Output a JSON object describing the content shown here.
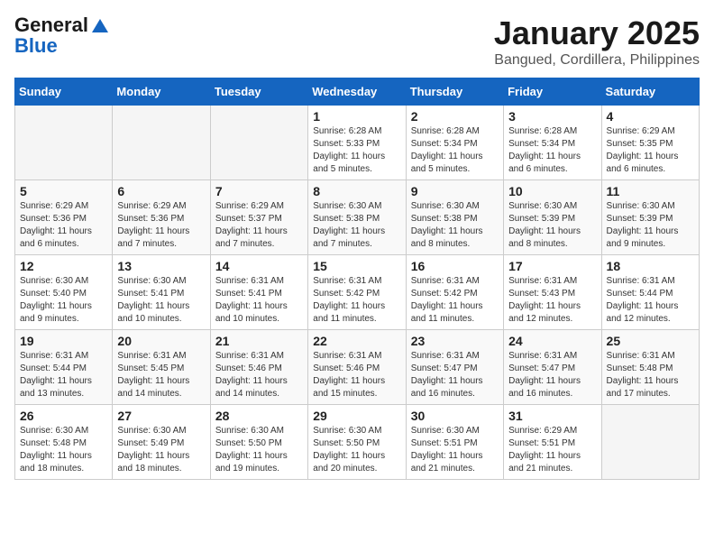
{
  "header": {
    "logo_line1": "General",
    "logo_line2": "Blue",
    "month": "January 2025",
    "location": "Bangued, Cordillera, Philippines"
  },
  "weekdays": [
    "Sunday",
    "Monday",
    "Tuesday",
    "Wednesday",
    "Thursday",
    "Friday",
    "Saturday"
  ],
  "weeks": [
    [
      {
        "day": "",
        "sunrise": "",
        "sunset": "",
        "daylight": ""
      },
      {
        "day": "",
        "sunrise": "",
        "sunset": "",
        "daylight": ""
      },
      {
        "day": "",
        "sunrise": "",
        "sunset": "",
        "daylight": ""
      },
      {
        "day": "1",
        "sunrise": "Sunrise: 6:28 AM",
        "sunset": "Sunset: 5:33 PM",
        "daylight": "Daylight: 11 hours and 5 minutes."
      },
      {
        "day": "2",
        "sunrise": "Sunrise: 6:28 AM",
        "sunset": "Sunset: 5:34 PM",
        "daylight": "Daylight: 11 hours and 5 minutes."
      },
      {
        "day": "3",
        "sunrise": "Sunrise: 6:28 AM",
        "sunset": "Sunset: 5:34 PM",
        "daylight": "Daylight: 11 hours and 6 minutes."
      },
      {
        "day": "4",
        "sunrise": "Sunrise: 6:29 AM",
        "sunset": "Sunset: 5:35 PM",
        "daylight": "Daylight: 11 hours and 6 minutes."
      }
    ],
    [
      {
        "day": "5",
        "sunrise": "Sunrise: 6:29 AM",
        "sunset": "Sunset: 5:36 PM",
        "daylight": "Daylight: 11 hours and 6 minutes."
      },
      {
        "day": "6",
        "sunrise": "Sunrise: 6:29 AM",
        "sunset": "Sunset: 5:36 PM",
        "daylight": "Daylight: 11 hours and 7 minutes."
      },
      {
        "day": "7",
        "sunrise": "Sunrise: 6:29 AM",
        "sunset": "Sunset: 5:37 PM",
        "daylight": "Daylight: 11 hours and 7 minutes."
      },
      {
        "day": "8",
        "sunrise": "Sunrise: 6:30 AM",
        "sunset": "Sunset: 5:38 PM",
        "daylight": "Daylight: 11 hours and 7 minutes."
      },
      {
        "day": "9",
        "sunrise": "Sunrise: 6:30 AM",
        "sunset": "Sunset: 5:38 PM",
        "daylight": "Daylight: 11 hours and 8 minutes."
      },
      {
        "day": "10",
        "sunrise": "Sunrise: 6:30 AM",
        "sunset": "Sunset: 5:39 PM",
        "daylight": "Daylight: 11 hours and 8 minutes."
      },
      {
        "day": "11",
        "sunrise": "Sunrise: 6:30 AM",
        "sunset": "Sunset: 5:39 PM",
        "daylight": "Daylight: 11 hours and 9 minutes."
      }
    ],
    [
      {
        "day": "12",
        "sunrise": "Sunrise: 6:30 AM",
        "sunset": "Sunset: 5:40 PM",
        "daylight": "Daylight: 11 hours and 9 minutes."
      },
      {
        "day": "13",
        "sunrise": "Sunrise: 6:30 AM",
        "sunset": "Sunset: 5:41 PM",
        "daylight": "Daylight: 11 hours and 10 minutes."
      },
      {
        "day": "14",
        "sunrise": "Sunrise: 6:31 AM",
        "sunset": "Sunset: 5:41 PM",
        "daylight": "Daylight: 11 hours and 10 minutes."
      },
      {
        "day": "15",
        "sunrise": "Sunrise: 6:31 AM",
        "sunset": "Sunset: 5:42 PM",
        "daylight": "Daylight: 11 hours and 11 minutes."
      },
      {
        "day": "16",
        "sunrise": "Sunrise: 6:31 AM",
        "sunset": "Sunset: 5:42 PM",
        "daylight": "Daylight: 11 hours and 11 minutes."
      },
      {
        "day": "17",
        "sunrise": "Sunrise: 6:31 AM",
        "sunset": "Sunset: 5:43 PM",
        "daylight": "Daylight: 11 hours and 12 minutes."
      },
      {
        "day": "18",
        "sunrise": "Sunrise: 6:31 AM",
        "sunset": "Sunset: 5:44 PM",
        "daylight": "Daylight: 11 hours and 12 minutes."
      }
    ],
    [
      {
        "day": "19",
        "sunrise": "Sunrise: 6:31 AM",
        "sunset": "Sunset: 5:44 PM",
        "daylight": "Daylight: 11 hours and 13 minutes."
      },
      {
        "day": "20",
        "sunrise": "Sunrise: 6:31 AM",
        "sunset": "Sunset: 5:45 PM",
        "daylight": "Daylight: 11 hours and 14 minutes."
      },
      {
        "day": "21",
        "sunrise": "Sunrise: 6:31 AM",
        "sunset": "Sunset: 5:46 PM",
        "daylight": "Daylight: 11 hours and 14 minutes."
      },
      {
        "day": "22",
        "sunrise": "Sunrise: 6:31 AM",
        "sunset": "Sunset: 5:46 PM",
        "daylight": "Daylight: 11 hours and 15 minutes."
      },
      {
        "day": "23",
        "sunrise": "Sunrise: 6:31 AM",
        "sunset": "Sunset: 5:47 PM",
        "daylight": "Daylight: 11 hours and 16 minutes."
      },
      {
        "day": "24",
        "sunrise": "Sunrise: 6:31 AM",
        "sunset": "Sunset: 5:47 PM",
        "daylight": "Daylight: 11 hours and 16 minutes."
      },
      {
        "day": "25",
        "sunrise": "Sunrise: 6:31 AM",
        "sunset": "Sunset: 5:48 PM",
        "daylight": "Daylight: 11 hours and 17 minutes."
      }
    ],
    [
      {
        "day": "26",
        "sunrise": "Sunrise: 6:30 AM",
        "sunset": "Sunset: 5:48 PM",
        "daylight": "Daylight: 11 hours and 18 minutes."
      },
      {
        "day": "27",
        "sunrise": "Sunrise: 6:30 AM",
        "sunset": "Sunset: 5:49 PM",
        "daylight": "Daylight: 11 hours and 18 minutes."
      },
      {
        "day": "28",
        "sunrise": "Sunrise: 6:30 AM",
        "sunset": "Sunset: 5:50 PM",
        "daylight": "Daylight: 11 hours and 19 minutes."
      },
      {
        "day": "29",
        "sunrise": "Sunrise: 6:30 AM",
        "sunset": "Sunset: 5:50 PM",
        "daylight": "Daylight: 11 hours and 20 minutes."
      },
      {
        "day": "30",
        "sunrise": "Sunrise: 6:30 AM",
        "sunset": "Sunset: 5:51 PM",
        "daylight": "Daylight: 11 hours and 21 minutes."
      },
      {
        "day": "31",
        "sunrise": "Sunrise: 6:29 AM",
        "sunset": "Sunset: 5:51 PM",
        "daylight": "Daylight: 11 hours and 21 minutes."
      },
      {
        "day": "",
        "sunrise": "",
        "sunset": "",
        "daylight": ""
      }
    ]
  ]
}
